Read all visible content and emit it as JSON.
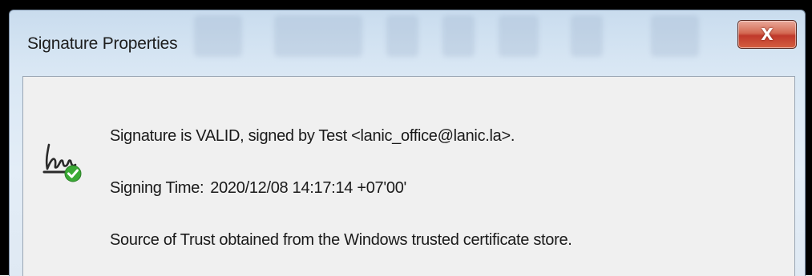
{
  "dialog": {
    "title": "Signature Properties",
    "close_label": "X"
  },
  "signature": {
    "status_line": "Signature is VALID, signed by Test <lanic_office@lanic.la>.",
    "signing_time_label": "Signing Time:",
    "signing_time_value": "2020/12/08 14:17:14 +07'00'",
    "trust_source": "Source of Trust obtained from the Windows trusted certificate store.",
    "icon": "signature-valid-icon"
  },
  "colors": {
    "valid_check": "#3aaa35",
    "close_button": "#c0392b"
  }
}
